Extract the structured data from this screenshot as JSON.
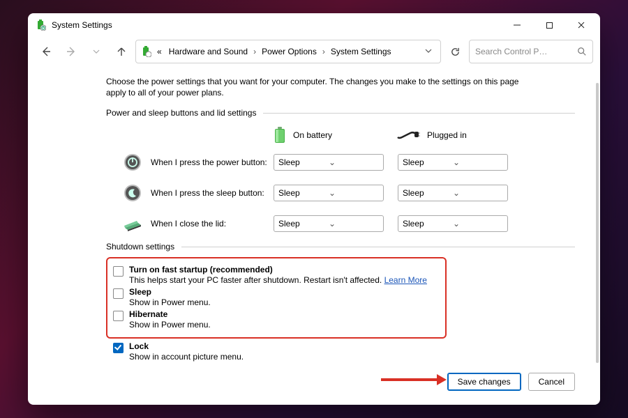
{
  "window": {
    "title": "System Settings"
  },
  "breadcrumb": {
    "root_marker": "«",
    "items": [
      "Hardware and Sound",
      "Power Options",
      "System Settings"
    ]
  },
  "search": {
    "placeholder": "Search Control P…"
  },
  "intro": "Choose the power settings that you want for your computer. The changes you make to the settings on this page apply to all of your power plans.",
  "section1": {
    "title": "Power and sleep buttons and lid settings"
  },
  "colheads": {
    "battery": "On battery",
    "plugged": "Plugged in"
  },
  "rows": {
    "power_button": {
      "label": "When I press the power button:",
      "battery": "Sleep",
      "plugged": "Sleep"
    },
    "sleep_button": {
      "label": "When I press the sleep button:",
      "battery": "Sleep",
      "plugged": "Sleep"
    },
    "lid": {
      "label": "When I close the lid:",
      "battery": "Sleep",
      "plugged": "Sleep"
    }
  },
  "section2": {
    "title": "Shutdown settings"
  },
  "shutdown": {
    "fast_startup": {
      "label": "Turn on fast startup (recommended)",
      "desc": "This helps start your PC faster after shutdown. Restart isn't affected. ",
      "link": "Learn More",
      "checked": false
    },
    "sleep": {
      "label": "Sleep",
      "desc": "Show in Power menu.",
      "checked": false
    },
    "hibernate": {
      "label": "Hibernate",
      "desc": "Show in Power menu.",
      "checked": false
    },
    "lock": {
      "label": "Lock",
      "desc": "Show in account picture menu.",
      "checked": true
    }
  },
  "buttons": {
    "save": "Save changes",
    "cancel": "Cancel"
  }
}
